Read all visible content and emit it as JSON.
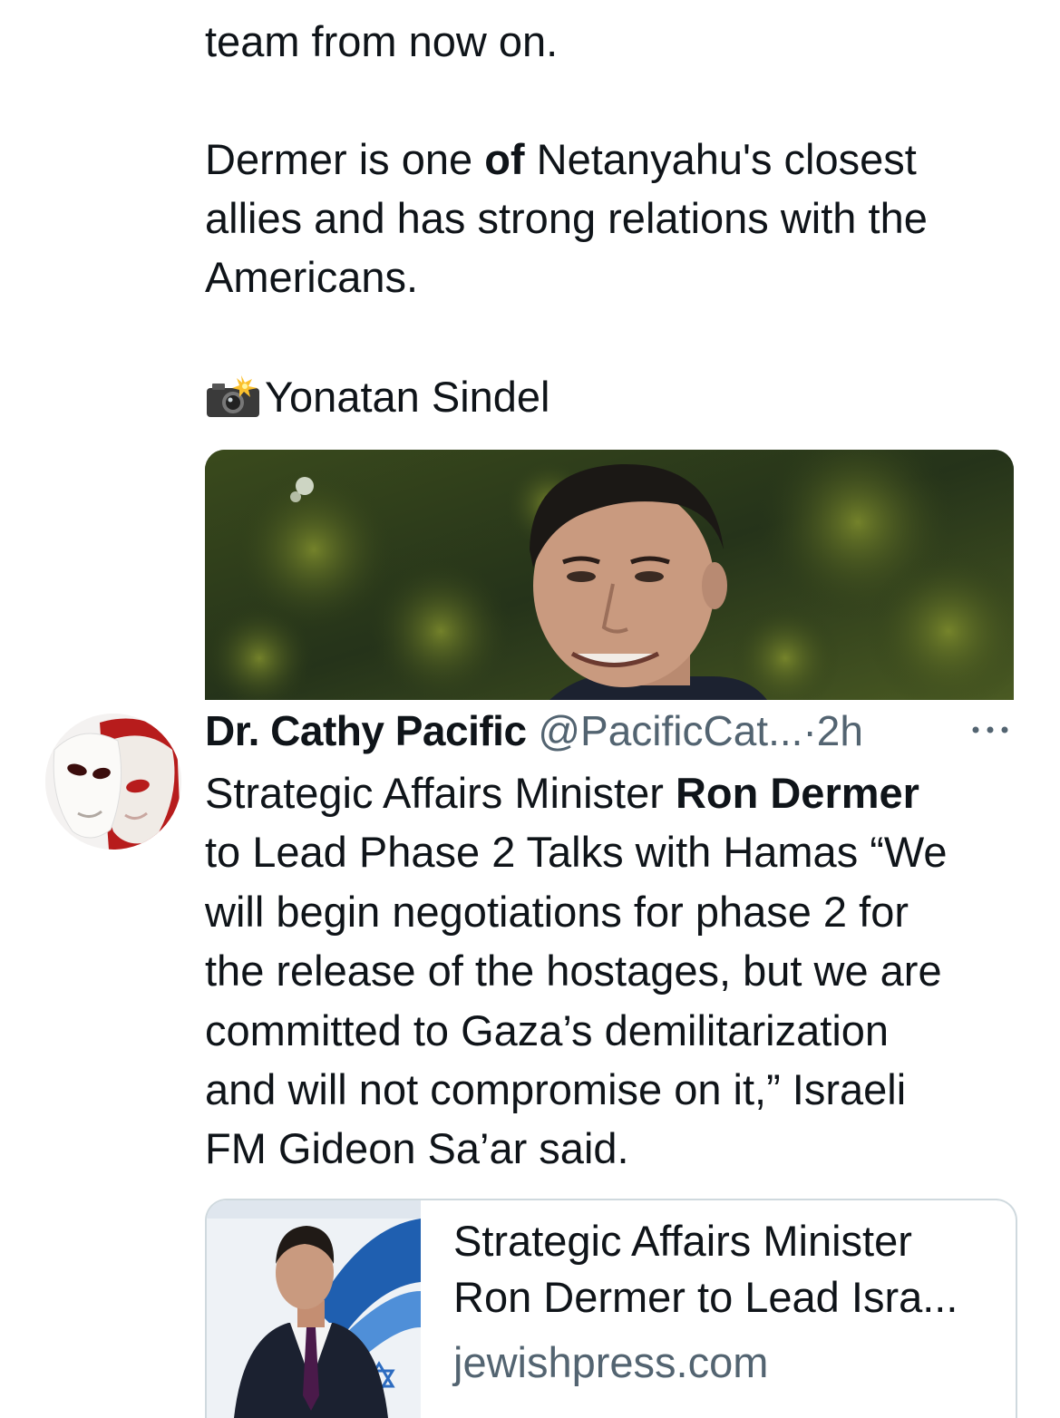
{
  "post_text": {
    "line_1": "team from now on.",
    "line_2_pre": "Dermer is one ",
    "line_2_bold": "of",
    "line_2_post": " Netanyahu's closest",
    "line_3": "allies and has strong relations with the",
    "line_4": "Americans.",
    "credit_name": "Yonatan Sindel"
  },
  "media": {
    "icon": "camera-flash-icon"
  },
  "tweet": {
    "display_name": "Dr. Cathy Pacific",
    "handle": "@PacificCat...",
    "separator": "·",
    "time": "2h",
    "more_icon": "more-dots-icon",
    "body_line_1_pre": "Strategic Affairs Minister ",
    "body_line_1_bold": "Ron Dermer",
    "body_line_2": "to Lead Phase 2 Talks with Hamas “We",
    "body_line_3": "will begin negotiations for phase 2 for",
    "body_line_4": "the release of the hostages, but we are",
    "body_line_5": "committed to Gaza’s demilitarization",
    "body_line_6": "and will not compromise on it,” Israeli",
    "body_line_7": "FM Gideon Sa’ar said."
  },
  "link_card": {
    "title_line_1": "Strategic Affairs Minister",
    "title_line_2": "Ron Dermer to Lead Isra...",
    "domain": "jewishpress.com"
  },
  "colors": {
    "text": "#0f1419",
    "secondary": "#536471",
    "border": "#cfd9de"
  }
}
